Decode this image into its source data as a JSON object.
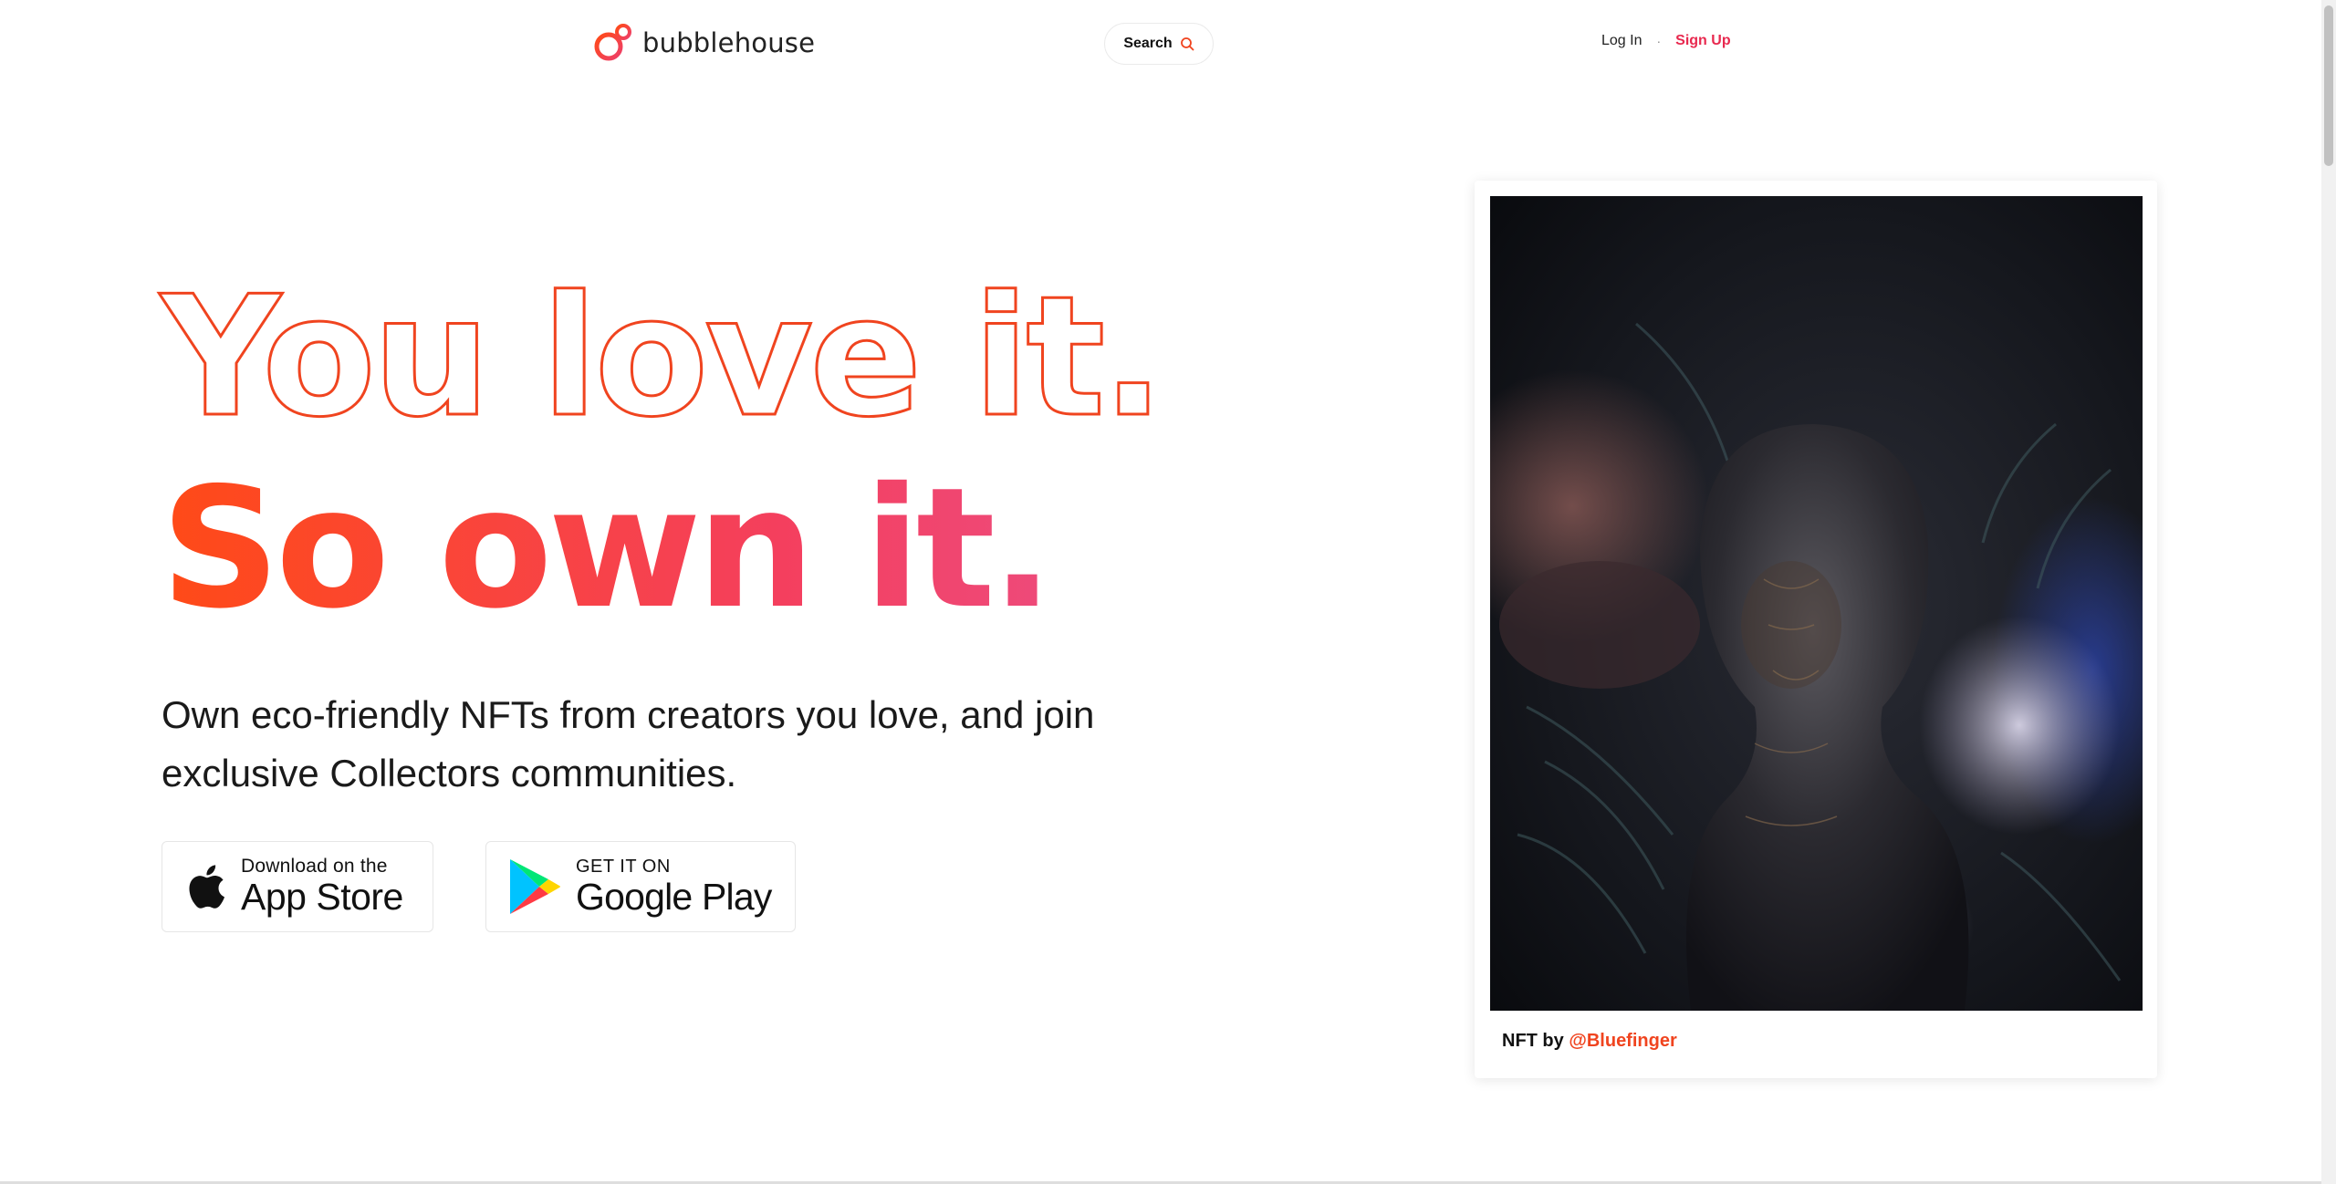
{
  "header": {
    "logo_text": "bubblehouse",
    "search_label": "Search",
    "login_label": "Log In",
    "separator": "·",
    "signup_label": "Sign Up"
  },
  "hero": {
    "headline_line1": "You love it.",
    "headline_line2": "So own it.",
    "subtitle": "Own eco-friendly NFTs from creators you love, and join exclusive Collectors communities."
  },
  "stores": {
    "apple": {
      "small": "Download on the",
      "big": "App Store",
      "icon": "apple-icon"
    },
    "google": {
      "small": "GET IT ON",
      "big": "Google Play",
      "icon": "google-play-icon"
    }
  },
  "nft_card": {
    "caption_prefix": "NFT by",
    "creator": "@Bluefinger"
  },
  "colors": {
    "accent": "#f0441f",
    "signup": "#e8294f",
    "gradient_start": "#ff4a17",
    "gradient_end": "#ee4a7a"
  }
}
